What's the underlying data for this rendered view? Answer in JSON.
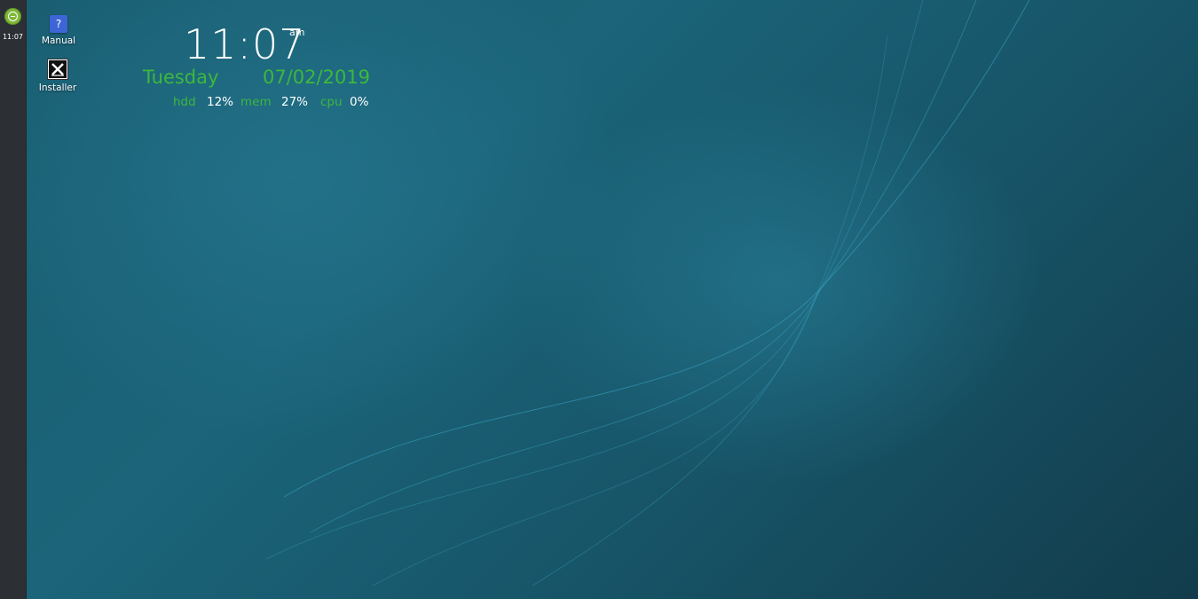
{
  "panel": {
    "menu_icon": "menu-logo-icon",
    "clock": "11:07"
  },
  "desktop_icons": [
    {
      "label": "Manual",
      "icon": "help-icon",
      "glyph": "?"
    },
    {
      "label": "Installer",
      "icon": "installer-icon"
    }
  ],
  "conky": {
    "time": "11:07",
    "ampm": "am",
    "day": "Tuesday",
    "date": "07/02/2019",
    "stats": {
      "hdd_label": "hdd",
      "hdd_value": "12%",
      "mem_label": "mem",
      "mem_value": "27%",
      "cpu_label": "cpu",
      "cpu_value": "0%"
    }
  },
  "colors": {
    "accent_green": "#3db83d",
    "panel_bg": "#2c3035",
    "menu_button": "#7fb83a",
    "wallpaper_teal": "#1a5e72"
  }
}
